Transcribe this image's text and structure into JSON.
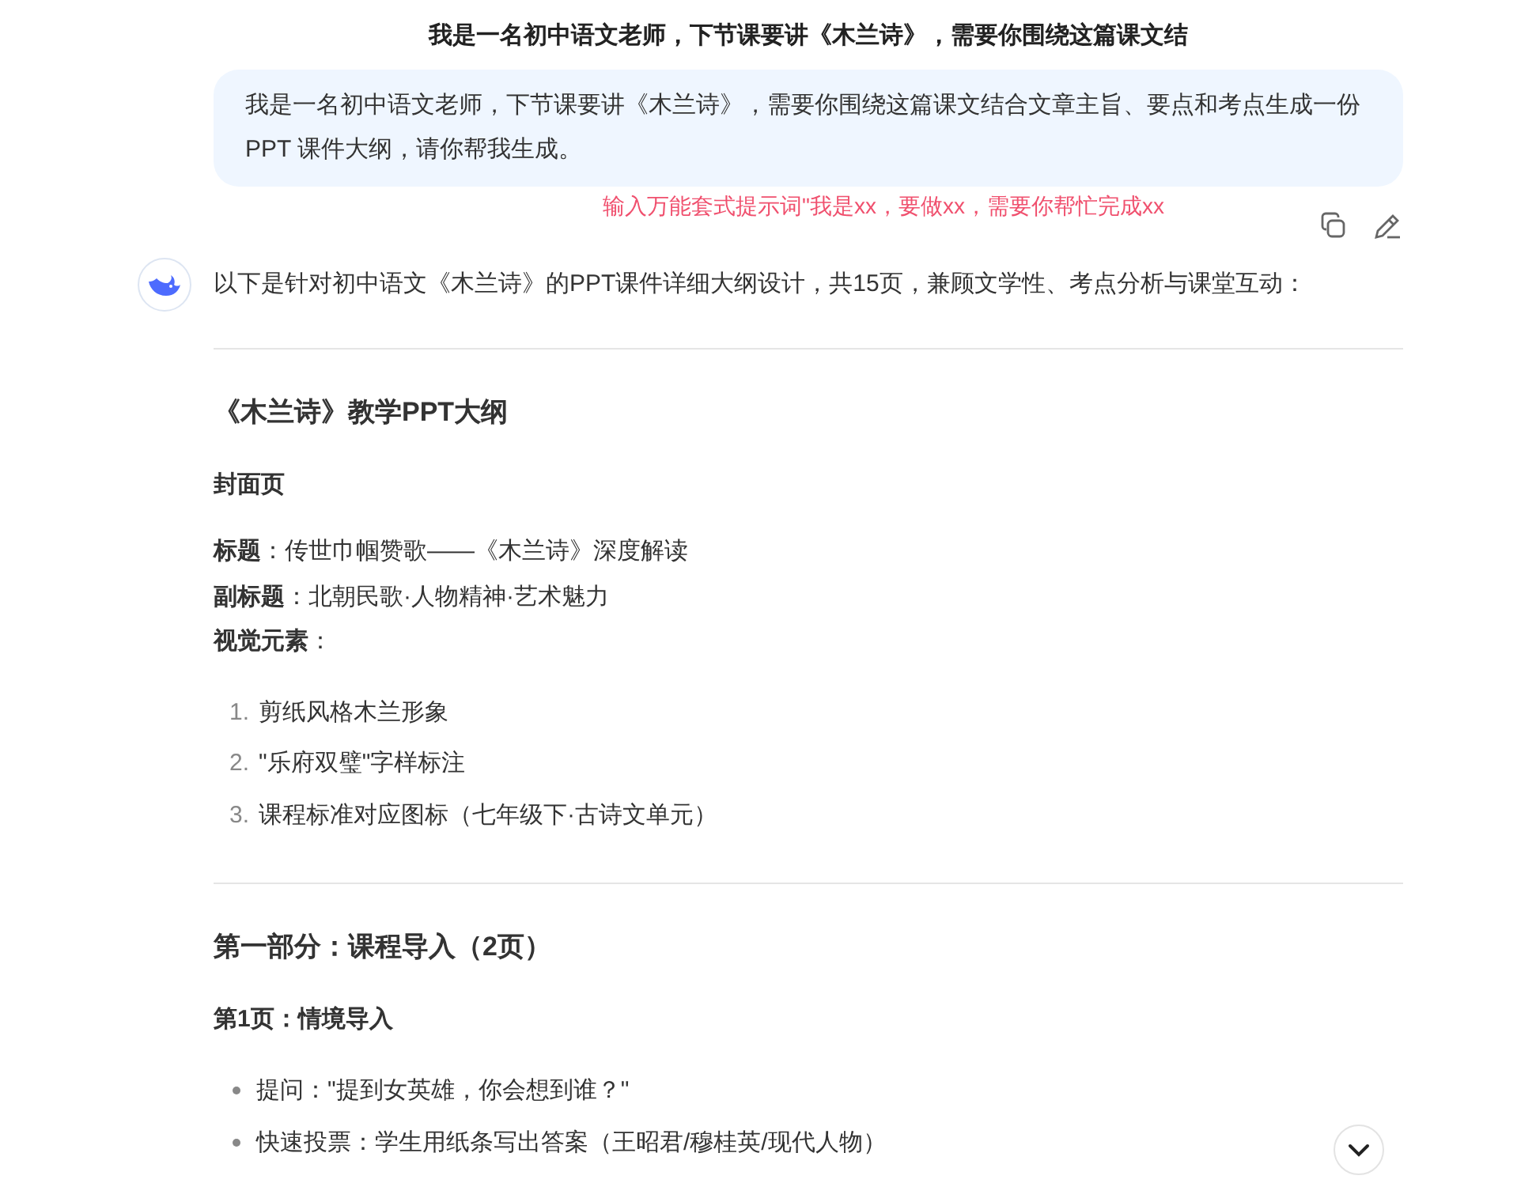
{
  "title": "我是一名初中语文老师，下节课要讲《木兰诗》，需要你围绕这篇课文结",
  "user_message": {
    "text": "我是一名初中语文老师，下节课要讲《木兰诗》，需要你围绕这篇课文结合文章主旨、要点和考点生成一份 PPT 课件大纲，请你帮我生成。",
    "annotation": "输入万能套式提示词\"我是xx，要做xx，需要你帮忙完成xx"
  },
  "reply": {
    "intro": "以下是针对初中语文《木兰诗》的PPT课件详细大纲设计，共15页，兼顾文学性、考点分析与课堂互动：",
    "blocks": [
      {
        "kind": "rule"
      },
      {
        "kind": "h3",
        "text": "《木兰诗》教学PPT大纲"
      },
      {
        "kind": "h4",
        "text": "封面页"
      },
      {
        "kind": "lines",
        "items": [
          "**标题**：传世巾帼赞歌——《木兰诗》深度解读",
          "**副标题**：北朝民歌·人物精神·艺术魅力",
          "**视觉元素**："
        ]
      },
      {
        "kind": "ol",
        "items": [
          {
            "number": "1.",
            "text": "剪纸风格木兰形象"
          },
          {
            "number": "2.",
            "text": "\"乐府双璧\"字样标注"
          },
          {
            "number": "3.",
            "text": "课程标准对应图标（七年级下·古诗文单元）"
          }
        ]
      },
      {
        "kind": "rule"
      },
      {
        "kind": "h3",
        "text": "第一部分：课程导入（2页）"
      },
      {
        "kind": "h4",
        "text": "第1页：情境导入"
      },
      {
        "kind": "ul",
        "items": [
          {
            "text": "提问：\"提到女英雄，你会想到谁？\""
          },
          {
            "text": "快速投票：学生用纸条写出答案（王昭君/穆桂英/现代人物）"
          }
        ]
      }
    ]
  }
}
